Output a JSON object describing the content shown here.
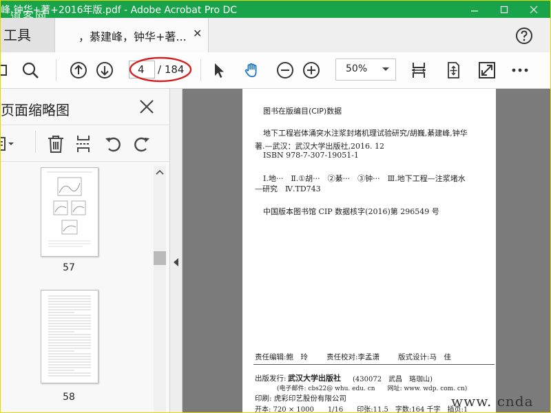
{
  "window": {
    "title": "峰,钟华+著+2016年版.pdf - Adobe Acrobat Pro DC",
    "watermark_logo": "道客网"
  },
  "tabs": {
    "tools_label": "工具",
    "document_label": "，綦建峰，钟华+著..."
  },
  "toolbar": {
    "current_page": "4",
    "total_pages": "/ 184",
    "zoom": "50%"
  },
  "panel": {
    "title": "页面缩略图",
    "thumbnails": [
      {
        "label": "57"
      },
      {
        "label": "58"
      }
    ]
  },
  "document_page": {
    "cip_heading": "图书在版编目(CIP)数据",
    "cip_line1": "地下工程岩体涌突水注浆封堵机理试验研究/胡巍,綦建峰,钟华",
    "cip_line2": "著.—武汉：武汉大学出版社,2016. 12",
    "isbn": "ISBN 978-7-307-19051-1",
    "classification_line1": "Ⅰ.地···　Ⅱ.①胡···　②綦···　③钟···　Ⅲ.地下工程—注浆堵水",
    "classification_line2": "—研究　Ⅳ.TD743",
    "library_record": "中国版本图书馆 CIP 数据核字(2016)第 296549 号",
    "editor": "责任编辑:鲍　玲",
    "proofreader": "责任校对:李孟潇",
    "designer": "版式设计:马　佳",
    "publisher_label": "出版发行:",
    "publisher_name": "武汉大学出版社",
    "publisher_address": "(430072　武昌　珞珈山)",
    "publisher_contact": "(电子邮件: cbs22@ whu. edu. cn　　网址: www. wdp. com. cn)",
    "printer": "印刷: 虎彩印艺股份有限公司",
    "format_line": "开本: 720 × 1000　　1/16　　印张:11.5　字数:164 千字　插页:1"
  },
  "watermark": "www. cnda",
  "colors": {
    "title_bar": "#19a34a",
    "annotation_circle": "#d42020",
    "doc_background": "#7b7b7b"
  }
}
